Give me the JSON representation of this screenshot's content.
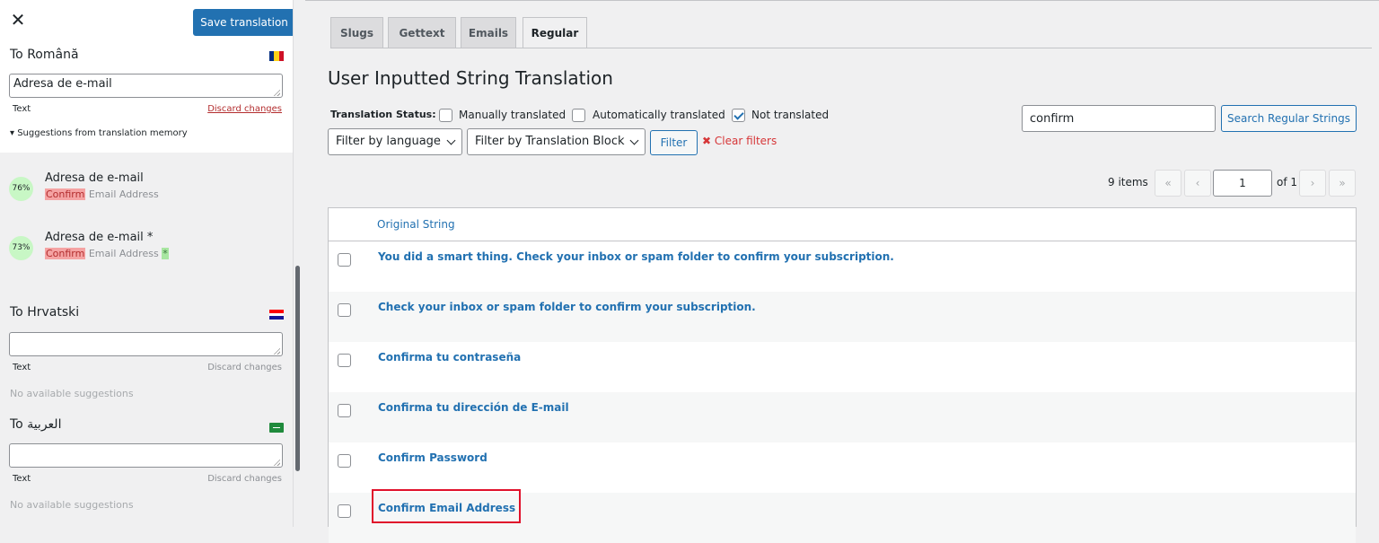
{
  "sidebar": {
    "save_label": "Save translation",
    "sections": [
      {
        "title": "To Română",
        "value": "Adresa de e-mail",
        "text_label": "Text",
        "discard_label": "Discard changes",
        "suggestions_toggle": "▾ Suggestions from translation memory",
        "suggestions": [
          {
            "percent": "76%",
            "translation": "Adresa de e-mail",
            "match": "Confirm",
            "rest": " Email Address",
            "extra": ""
          },
          {
            "percent": "73%",
            "translation": "Adresa de e-mail *",
            "match": "Confirm",
            "rest": " Email Address ",
            "extra": "*"
          }
        ]
      },
      {
        "title": "To Hrvatski",
        "value": "",
        "text_label": "Text",
        "discard_label": "Discard changes",
        "no_suggestions": "No available suggestions"
      },
      {
        "title": "To العربية",
        "value": "",
        "text_label": "Text",
        "discard_label": "Discard changes",
        "no_suggestions": "No available suggestions"
      }
    ]
  },
  "main": {
    "tabs": [
      "Slugs",
      "Gettext",
      "Emails",
      "Regular"
    ],
    "active_tab": "Regular",
    "title": "User Inputted String Translation",
    "status_label": "Translation Status:",
    "status_options": [
      {
        "label": "Manually translated",
        "checked": false
      },
      {
        "label": "Automatically translated",
        "checked": false
      },
      {
        "label": "Not translated",
        "checked": true
      }
    ],
    "filter_language": "Filter by language",
    "filter_block": "Filter by Translation Block",
    "filter_button": "Filter",
    "clear_filters": "✖ Clear filters",
    "search_value": "confirm",
    "search_button": "Search Regular Strings",
    "pagination": {
      "items": "9 items",
      "first": "«",
      "prev": "‹",
      "current_page": "1",
      "of": "of 1",
      "next": "›",
      "last": "»"
    },
    "table": {
      "column_header": "Original String",
      "rows": [
        "You did a smart thing. Check your inbox or spam folder to confirm your subscription.",
        "Check your inbox or spam folder to confirm your subscription.",
        "Confirma tu contraseña",
        "Confirma tu dirección de E-mail",
        "Confirm Password",
        "Confirm Email Address"
      ]
    }
  },
  "colors": {
    "accent": "#2271b1",
    "highlight": "#e0112b",
    "danger": "#d63638",
    "suggestion_badge": "#c8f7c5"
  }
}
